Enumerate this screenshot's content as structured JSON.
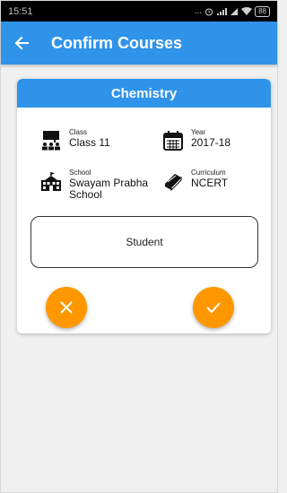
{
  "status_bar": {
    "time": "15:51",
    "dots": "...",
    "battery": "88"
  },
  "app_bar": {
    "title": "Confirm Courses"
  },
  "card": {
    "title": "Chemistry",
    "class": {
      "label": "Class",
      "value": "Class 11"
    },
    "year": {
      "label": "Year",
      "value": "2017-18"
    },
    "school": {
      "label": "School",
      "value": "Swayam Prabha School"
    },
    "curriculum": {
      "label": "Curriculum",
      "value": "NCERT"
    },
    "role": "Student"
  },
  "colors": {
    "primary": "#2f93ea",
    "accent": "#ff9800"
  }
}
